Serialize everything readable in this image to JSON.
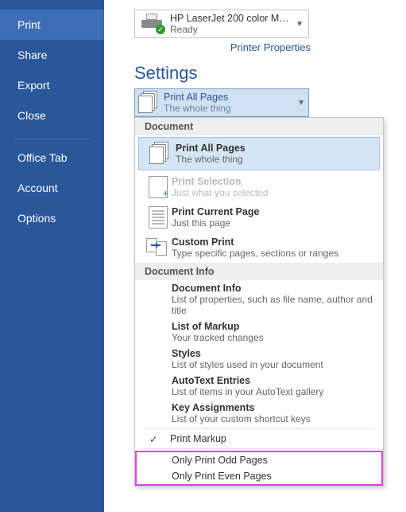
{
  "sidebar": {
    "items": [
      {
        "label": "Print",
        "active": true
      },
      {
        "label": "Share"
      },
      {
        "label": "Export"
      },
      {
        "label": "Close"
      }
    ],
    "sep": true,
    "items2": [
      {
        "label": "Office Tab"
      },
      {
        "label": "Account"
      },
      {
        "label": "Options"
      }
    ]
  },
  "printer": {
    "name": "HP LaserJet 200 color MFP...",
    "status": "Ready",
    "properties": "Printer Properties"
  },
  "settings": {
    "heading": "Settings",
    "selected_title": "Print All Pages",
    "selected_sub": "The whole thing"
  },
  "dropdown": {
    "section1": "Document",
    "items": [
      {
        "icon": "docs",
        "title": "Print All Pages",
        "sub": "The whole thing",
        "hl": true
      },
      {
        "icon": "pageplus",
        "title": "Print Selection",
        "sub": "Just what you selected",
        "disabled": true
      },
      {
        "icon": "page",
        "title": "Print Current Page",
        "sub": "Just this page"
      },
      {
        "icon": "arrow",
        "title": "Custom Print",
        "sub": "Type specific pages, sections or ranges"
      }
    ],
    "section2": "Document Info",
    "info_items": [
      {
        "title": "Document Info",
        "sub": "List of properties, such as file name, author and title"
      },
      {
        "title": "List of Markup",
        "sub": "Your tracked changes"
      },
      {
        "title": "Styles",
        "sub": "List of styles used in your document"
      },
      {
        "title": "AutoText Entries",
        "sub": "List of items in your AutoText gallery"
      },
      {
        "title": "Key Assignments",
        "sub": "List of your custom shortcut keys"
      }
    ],
    "print_markup": "Print Markup",
    "odd": "Only Print Odd Pages",
    "even": "Only Print Even Pages"
  }
}
